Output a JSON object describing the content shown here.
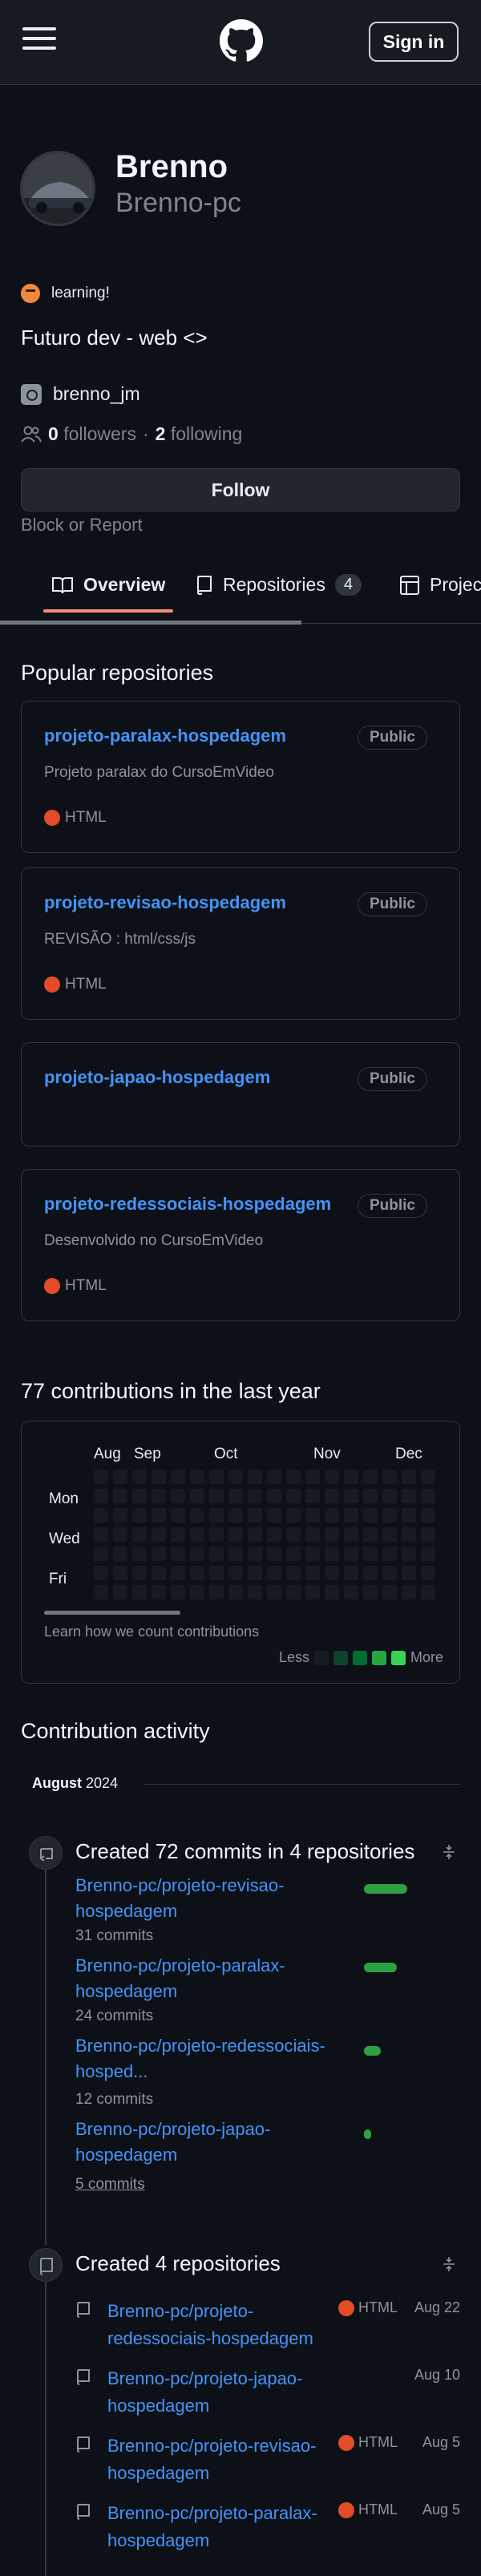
{
  "header": {
    "signin_label": "Sign in"
  },
  "profile": {
    "name": "Brenno",
    "login": "Brenno-pc",
    "status": "learning!",
    "bio": "Futuro dev - web <>",
    "social": "brenno_jm",
    "followers_count": "0",
    "followers_label": "followers",
    "separator": "·",
    "following_count": "2",
    "following_label": "following",
    "follow_label": "Follow",
    "block_label": "Block or Report"
  },
  "tabs": [
    {
      "label": "Overview",
      "icon": "book-open-icon"
    },
    {
      "label": "Repositories",
      "count": "4",
      "icon": "repo-icon"
    },
    {
      "label": "Projects",
      "icon": "table-icon"
    }
  ],
  "popular": {
    "title": "Popular repositories",
    "repos": [
      {
        "name": "projeto-paralax-hospedagem",
        "visibility": "Public",
        "description": "Projeto paralax do CursoEmVideo",
        "language": "HTML"
      },
      {
        "name": "projeto-revisao-hospedagem",
        "visibility": "Public",
        "description": "REVISÃO : html/css/js",
        "language": "HTML"
      },
      {
        "name": "projeto-japao-hospedagem",
        "visibility": "Public",
        "description": "",
        "language": ""
      },
      {
        "name": "projeto-redessociais-hospedagem",
        "visibility": "Public",
        "description": "Desenvolvido no CursoEmVideo",
        "language": "HTML"
      }
    ],
    "language_color": "#e34c26"
  },
  "contributions": {
    "title": "77 contributions in the last year",
    "months": [
      "Aug",
      "Sep",
      "Oct",
      "Nov",
      "Dec"
    ],
    "days": [
      "Mon",
      "Wed",
      "Fri"
    ],
    "learn": "Learn how we count contributions",
    "less": "Less",
    "more": "More",
    "legend_colors": [
      "#161b22",
      "#0e4429",
      "#006d32",
      "#26a641",
      "#39d353"
    ]
  },
  "activity": {
    "title": "Contribution activity",
    "period_month": "August",
    "period_year": "2024",
    "commits_title": "Created 72 commits in 4 repositories",
    "commits": [
      {
        "repo": "Brenno-pc/projeto-revisao-hospedagem",
        "count": "31 commits",
        "fraction": 0.43
      },
      {
        "repo": "Brenno-pc/projeto-paralax-hospedagem",
        "count": "24 commits",
        "fraction": 0.33
      },
      {
        "repo": "Brenno-pc/projeto-redessociais-hosped...",
        "count": "12 commits",
        "fraction": 0.17
      },
      {
        "repo": "Brenno-pc/projeto-japao-hospedagem",
        "count": "5 commits",
        "fraction": 0.07
      }
    ],
    "created_title": "Created 4 repositories",
    "created": [
      {
        "repo": "Brenno-pc/projeto-redessociais-hospedagem",
        "language": "HTML",
        "date": "Aug 22"
      },
      {
        "repo": "Brenno-pc/projeto-japao-hospedagem",
        "language": "",
        "date": "Aug 10"
      },
      {
        "repo": "Brenno-pc/projeto-revisao-hospedagem",
        "language": "HTML",
        "date": "Aug 5"
      },
      {
        "repo": "Brenno-pc/projeto-paralax-hospedagem",
        "language": "HTML",
        "date": "Aug 5"
      }
    ]
  }
}
